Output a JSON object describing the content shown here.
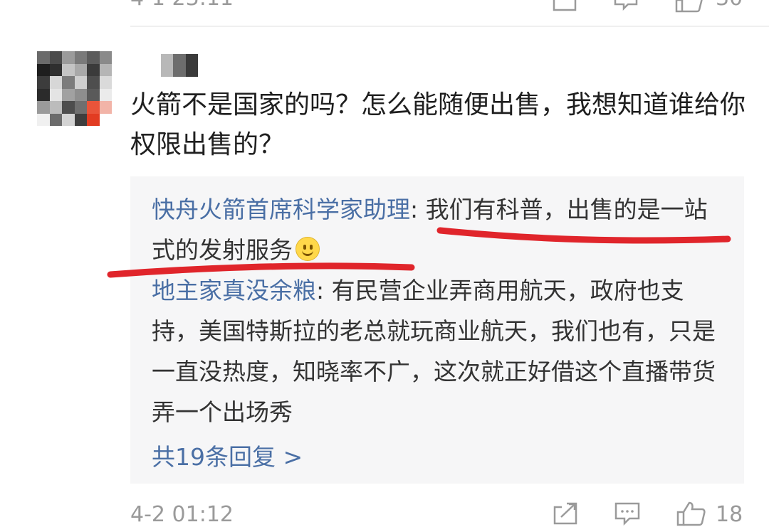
{
  "comment": {
    "text": "火箭不是国家的吗？怎么能随便出售，我想知道谁给你权限出售的？",
    "time": "4-2 01:12",
    "like_count": "18"
  },
  "replies": [
    {
      "username": "快舟火箭首席科学家助理",
      "separator": ": ",
      "text": "我们有科普，出售的是一站式的发射服务",
      "emoji": "smile-emoji"
    },
    {
      "username": "地主家真没余粮",
      "separator": ": ",
      "text": "有民营企业弄商用航天，政府也支持，美国特斯拉的老总就玩商业航天，我们也有，只是一直没热度，知晓率不广，这次就正好借这个直播带货弄一个出场秀"
    }
  ],
  "more_replies": "共19条回复 >",
  "previous_comment": {
    "like_count": "30"
  },
  "colors": {
    "link_blue": "#4a6fa5",
    "reply_bg": "#f6f6f7",
    "annotation_red": "#e0252b",
    "meta_gray": "#9a9a9a"
  },
  "icons": [
    "share-icon",
    "comment-icon",
    "like-icon",
    "smile-emoji"
  ]
}
